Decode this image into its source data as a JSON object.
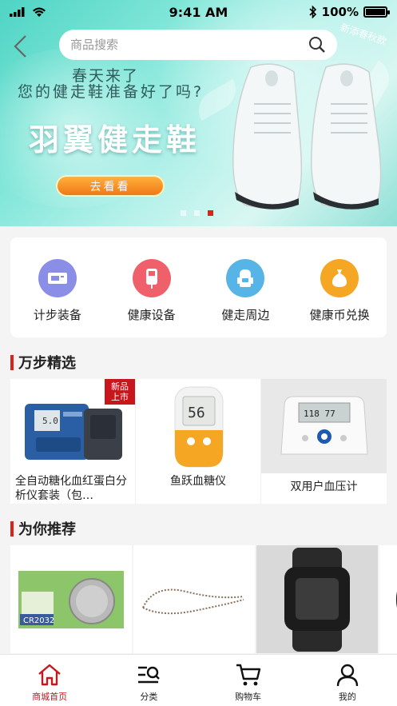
{
  "status_bar": {
    "time": "9:41 AM",
    "battery": "100%"
  },
  "search": {
    "placeholder": "商品搜索"
  },
  "banner": {
    "season_tag": "新添春秋款",
    "line1": "春天来了",
    "line2": "您的健走鞋准备好了吗?",
    "headline": "羽翼健走鞋",
    "cta": "去看看",
    "slides": 3,
    "active_slide": 3
  },
  "categories": [
    {
      "label": "计步装备",
      "icon": "pedometer-icon",
      "color": "#8b8ee6"
    },
    {
      "label": "健康设备",
      "icon": "glucose-meter-icon",
      "color": "#f0606a"
    },
    {
      "label": "健走周边",
      "icon": "backpack-icon",
      "color": "#56b4e6"
    },
    {
      "label": "健康币兑换",
      "icon": "coin-bag-icon",
      "color": "#f5a623"
    }
  ],
  "section_featured": {
    "title": "万步精选"
  },
  "featured": [
    {
      "name": "全自动糖化血红蛋白分析仪套装（包…",
      "tag": "新品\n上市"
    },
    {
      "name": "鱼跃血糖仪",
      "tag": ""
    },
    {
      "name": "双用户血压计",
      "tag": ""
    }
  ],
  "section_recommend": {
    "title": "为你推荐"
  },
  "recommend": [
    {
      "icon": "battery-cell-icon",
      "caption": "CR2032"
    },
    {
      "icon": "lanyard-icon",
      "caption": ""
    },
    {
      "icon": "watch-band-icon",
      "caption": ""
    },
    {
      "icon": "band-partial-icon",
      "caption": ""
    }
  ],
  "tabs": [
    {
      "label": "商城首页",
      "icon": "home-icon",
      "active": true
    },
    {
      "label": "分类",
      "icon": "category-icon",
      "active": false
    },
    {
      "label": "购物车",
      "icon": "cart-icon",
      "active": false
    },
    {
      "label": "我的",
      "icon": "profile-icon",
      "active": false
    }
  ],
  "colors": {
    "accent": "#c8161d",
    "cta_orange": "#f07818"
  }
}
